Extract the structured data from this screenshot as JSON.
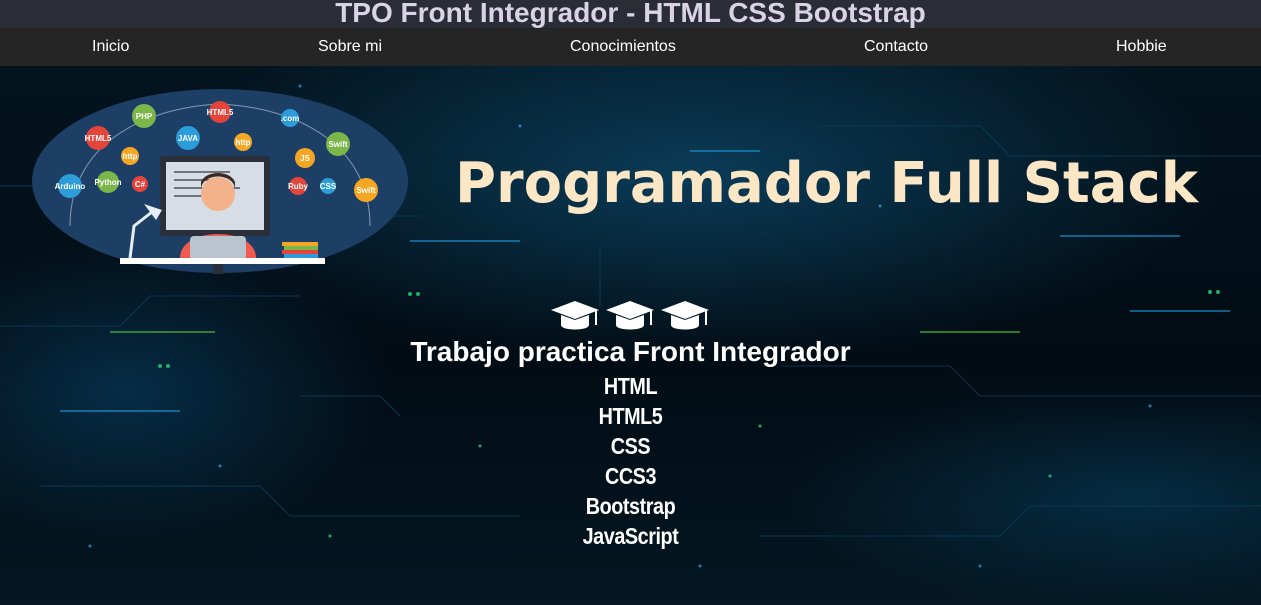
{
  "header": {
    "title": "TPO Front Integrador - HTML CSS Bootstrap"
  },
  "nav": {
    "items": [
      {
        "label": "Inicio"
      },
      {
        "label": "Sobre mi"
      },
      {
        "label": "Conocimientos"
      },
      {
        "label": "Contacto"
      },
      {
        "label": "Hobbie"
      }
    ]
  },
  "hero": {
    "heading": "Programador Full Stack",
    "cap_icons": [
      "graduation-cap-icon",
      "graduation-cap-icon",
      "graduation-cap-icon"
    ],
    "subtitle": "Trabajo practica Front Integrador",
    "tech": [
      "HTML",
      "HTML5",
      "CSS",
      "CCS3",
      "Bootstrap",
      "JavaScript"
    ],
    "illustration_labels": [
      "PHP",
      "HTML5",
      "HTML5",
      "JAVA",
      "http",
      "http",
      ".com",
      "JS",
      "Swift",
      "Swift",
      "Python",
      "C#",
      "Ruby",
      "CSS",
      "Arduino",
      "</>",
      "<->"
    ]
  },
  "colors": {
    "title_bar": "#2b2d36",
    "nav_bar": "#252525",
    "heading": "#fbe7c6",
    "text": "#ffffff",
    "illustration_bg": "#1d3f66"
  }
}
